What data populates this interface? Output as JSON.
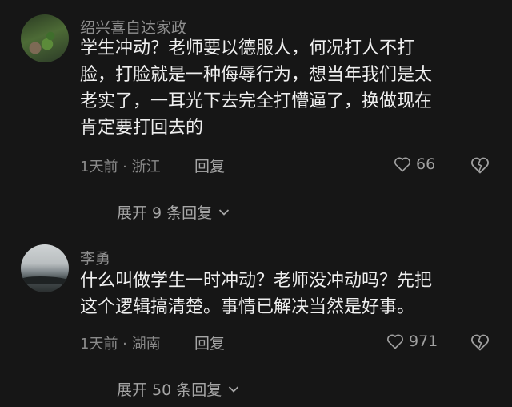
{
  "comments": [
    {
      "username": "绍兴喜自达家政",
      "text": "学生冲动？老师要以德服人，何况打人不打\n脸，打脸就是一种侮辱行为，想当年我们是太\n老实了，一耳光下去完全打懵逼了，换做现在\n肯定要打回去的",
      "meta": "1天前 · 浙江",
      "reply_label": "回复",
      "likes": "66",
      "expand_label": "展开 9 条回复"
    },
    {
      "username": "李勇",
      "text": "什么叫做学生一时冲动？老师没冲动吗？先把\n这个逻辑搞清楚。事情已解决当然是好事。",
      "meta": "1天前 · 湖南",
      "reply_label": "回复",
      "likes": "971",
      "expand_label": "展开 50 条回复"
    }
  ],
  "icons": {
    "like": "heart-outline-icon",
    "dislike": "broken-heart-icon",
    "expand": "chevron-down-icon"
  }
}
